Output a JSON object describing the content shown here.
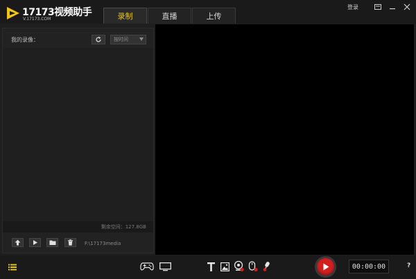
{
  "app": {
    "title": "17173视频助手",
    "url": "V.17173.COM",
    "colors": {
      "accent": "#e8c420",
      "record": "#d21f1f",
      "background": "#1f1f1f",
      "preview": "#000000"
    }
  },
  "tabs": [
    {
      "label": "录制",
      "active": true
    },
    {
      "label": "直播",
      "active": false
    },
    {
      "label": "上传",
      "active": false
    }
  ],
  "header": {
    "login_label": "登录"
  },
  "recordings": {
    "title": "我的录像：",
    "sort_selected": "按时间",
    "free_space": "剩余空间：127.8GB",
    "path": "F:\\17173media"
  },
  "icons": {
    "refresh": "refresh-icon",
    "upload": "upload-icon",
    "play": "play-icon",
    "folder": "folder-icon",
    "delete": "trash-icon",
    "list": "list-icon",
    "gamepad": "gamepad-icon",
    "monitor": "monitor-icon",
    "text": "text-icon",
    "image": "image-icon",
    "webcam": "webcam-icon",
    "mouse": "mouse-icon",
    "microphone": "microphone-icon"
  },
  "controls": {
    "timer": "00:00:00",
    "help_label": "?"
  }
}
